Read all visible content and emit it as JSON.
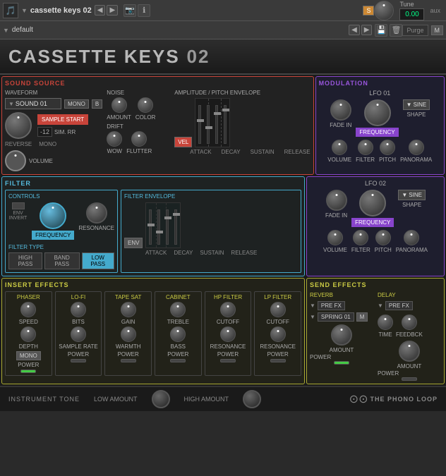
{
  "topbar": {
    "instrument": "cassette keys 02",
    "preset": "default",
    "tune_label": "Tune",
    "tune_value": "0.00",
    "aux_label": "aux"
  },
  "plugin": {
    "title": "CASSETTE KEYS",
    "number": "02"
  },
  "sound_source": {
    "title": "SOUND SOURCE",
    "waveform": {
      "label": "WAVEFORM",
      "sound_select": "SOUND 01",
      "mono_label": "MONO",
      "b_label": "B",
      "sample_start": "SAMPLE START",
      "reverse": "REVERSE",
      "mono": "MONO",
      "db_value": "-12",
      "sim_rr": "SIM. RR",
      "volume_label": "VOLUME"
    },
    "noise": {
      "label": "NOISE",
      "amount": "AMOUNT",
      "color": "COLOR"
    },
    "drift": {
      "label": "DRIFT",
      "wow": "WOW",
      "flutter": "FLUTTER"
    },
    "envelope": {
      "label": "AMPLITUDE / PITCH ENVELOPE",
      "vel": "VEL",
      "attack": "ATTACK",
      "decay": "DECAY",
      "sustain": "SUSTAIN",
      "release": "RELEASE"
    }
  },
  "modulation": {
    "title": "Modulation",
    "lfo01": {
      "label": "LFO 01",
      "fade_in": "FADE IN",
      "frequency": "FREQUENCY",
      "shape": "SHAPE",
      "sine": "SINE",
      "volume": "VOLUME",
      "filter": "FILTER",
      "pitch": "PITCH",
      "panorama": "PANORAMA"
    },
    "lfo02": {
      "label": "LFO 02",
      "fade_in": "FADE IN",
      "frequency": "FREQUENCY",
      "shape": "SHAPE",
      "sine": "SINE",
      "volume": "VOLUME",
      "filter": "FILTER",
      "pitch": "PITCH",
      "panorama": "PANORAMA"
    }
  },
  "filter": {
    "title": "FILTER",
    "controls": {
      "label": "CONTROLS",
      "env_invert": "ENV INVERT",
      "frequency": "FREQUENCY",
      "resonance": "RESONANCE"
    },
    "filter_type": {
      "label": "FILTER TYPE",
      "high_pass": "HIGH PASS",
      "band_pass": "BAND PASS",
      "low_pass": "LOW PASS"
    },
    "envelope": {
      "label": "FILTER ENVELOPE",
      "env": "ENV",
      "attack": "ATTACK",
      "decay": "DECAY",
      "sustain": "SUSTAIN",
      "release": "RELEASE"
    }
  },
  "insert_effects": {
    "title": "INSERT EFFECTS",
    "phaser": {
      "label": "PHASER",
      "speed": "SPEED",
      "depth": "DEPTH",
      "power": "POWER"
    },
    "lofi": {
      "label": "LO-FI",
      "bits": "BITS",
      "sample_rate": "SAMPLE RATE",
      "power": "POWER"
    },
    "tape_sat": {
      "label": "TAPE SAT",
      "gain": "GAIN",
      "warmth": "WARMTH",
      "power": "POWER"
    },
    "cabinet": {
      "label": "CABINET",
      "treble": "TREBLE",
      "bass": "BASS",
      "power": "POWER"
    },
    "hp_filter": {
      "label": "HP FILTER",
      "cutoff": "CUTOFF",
      "resonance": "RESONANCE",
      "power": "POWER"
    },
    "lp_filter": {
      "label": "LP FILTER",
      "cutoff": "CUTOFF",
      "resonance": "RESONANCE",
      "power": "POWER"
    }
  },
  "send_effects": {
    "title": "SEND EFFECTS",
    "reverb": {
      "label": "REVERB",
      "pre_fx": "PRE FX",
      "spring_01": "SPRING 01",
      "m_label": "M",
      "amount": "AMOUNT",
      "power": "POWER"
    },
    "delay": {
      "label": "DELAY",
      "pre_fx": "PRE FX",
      "time": "TIME",
      "feedback": "FEEDBCK",
      "amount": "AMOUNT",
      "power": "POWER"
    }
  },
  "bottom_bar": {
    "instrument_tone": "INSTRUMENT TONE",
    "low_amount": "LOW AMOUNT",
    "high_amount": "HIGH AMOUNT",
    "logo": "THE PHONO LOOP"
  }
}
